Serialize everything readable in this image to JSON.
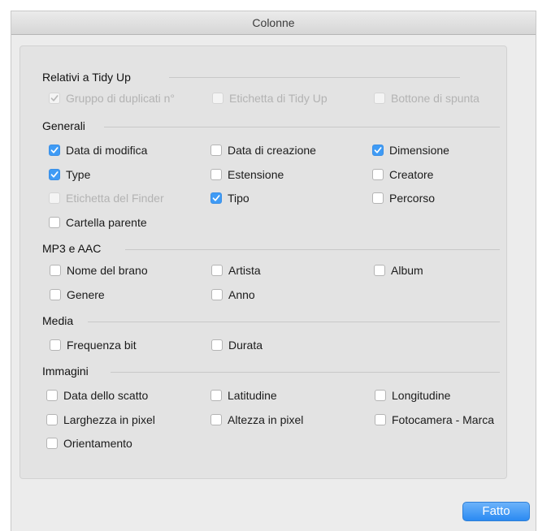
{
  "window": {
    "title": "Colonne"
  },
  "sections": [
    {
      "title": "Relativi a Tidy Up",
      "options": [
        {
          "label": "Gruppo di duplicati n°",
          "checked": true,
          "disabled": true
        },
        {
          "label": "Etichetta di Tidy Up",
          "checked": false,
          "disabled": true
        },
        {
          "label": "Bottone di spunta",
          "checked": false,
          "disabled": true
        }
      ]
    },
    {
      "title": "Generali",
      "options": [
        {
          "label": "Data di modifica",
          "checked": true,
          "disabled": false
        },
        {
          "label": "Data di creazione",
          "checked": false,
          "disabled": false
        },
        {
          "label": "Dimensione",
          "checked": true,
          "disabled": false
        },
        {
          "label": "Type",
          "checked": true,
          "disabled": false
        },
        {
          "label": "Estensione",
          "checked": false,
          "disabled": false
        },
        {
          "label": "Creatore",
          "checked": false,
          "disabled": false
        },
        {
          "label": "Etichetta del Finder",
          "checked": false,
          "disabled": true
        },
        {
          "label": "Tipo",
          "checked": true,
          "disabled": false
        },
        {
          "label": "Percorso",
          "checked": false,
          "disabled": false
        },
        {
          "label": "Cartella parente",
          "checked": false,
          "disabled": false
        }
      ]
    },
    {
      "title": "MP3 e AAC",
      "options": [
        {
          "label": "Nome del brano",
          "checked": false,
          "disabled": false
        },
        {
          "label": "Artista",
          "checked": false,
          "disabled": false
        },
        {
          "label": "Album",
          "checked": false,
          "disabled": false
        },
        {
          "label": "Genere",
          "checked": false,
          "disabled": false
        },
        {
          "label": "Anno",
          "checked": false,
          "disabled": false
        }
      ]
    },
    {
      "title": "Media",
      "options": [
        {
          "label": "Frequenza bit",
          "checked": false,
          "disabled": false
        },
        {
          "label": "Durata",
          "checked": false,
          "disabled": false
        }
      ]
    },
    {
      "title": "Immagini",
      "options": [
        {
          "label": "Data dello scatto",
          "checked": false,
          "disabled": false
        },
        {
          "label": "Latitudine",
          "checked": false,
          "disabled": false
        },
        {
          "label": "Longitudine",
          "checked": false,
          "disabled": false
        },
        {
          "label": "Larghezza in pixel",
          "checked": false,
          "disabled": false
        },
        {
          "label": "Altezza in pixel",
          "checked": false,
          "disabled": false
        },
        {
          "label": "Fotocamera - Marca",
          "checked": false,
          "disabled": false
        },
        {
          "label": "Orientamento",
          "checked": false,
          "disabled": false
        }
      ]
    }
  ],
  "footer": {
    "done_label": "Fatto"
  },
  "colors": {
    "accent": "#3f9bf5"
  }
}
